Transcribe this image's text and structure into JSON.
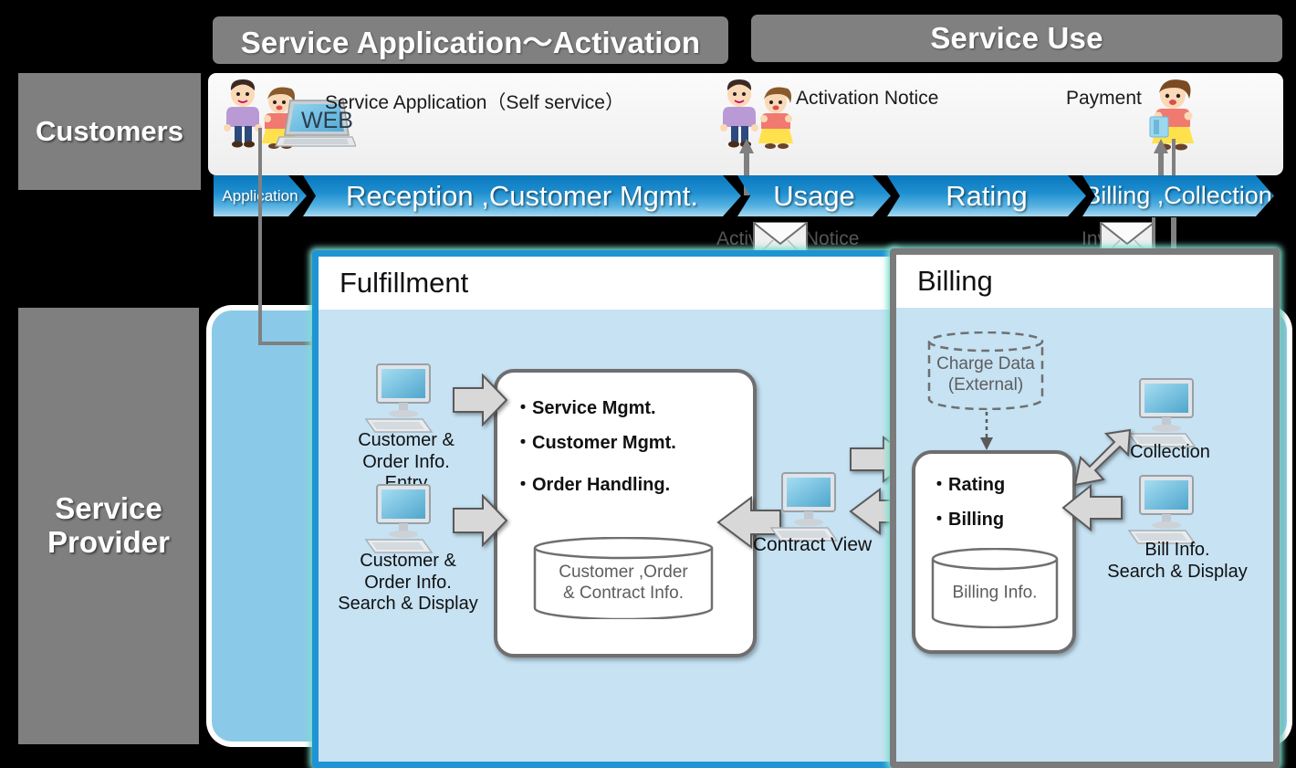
{
  "phases": [
    {
      "id": "application-activation",
      "label": "Service Application～Activation"
    },
    {
      "id": "service-use",
      "label": "Service Use"
    }
  ],
  "roles": {
    "customers": "Customers",
    "provider": "Service\nProvider"
  },
  "customer_lane": {
    "items": [
      {
        "id": "service-application",
        "label": "Service Application（Self service）"
      },
      {
        "id": "activation-notice",
        "label": "Activation Notice"
      },
      {
        "id": "payment",
        "label": "Payment"
      }
    ],
    "web_badge": "WEB"
  },
  "process_chevrons": [
    {
      "id": "application",
      "label": "Application"
    },
    {
      "id": "reception-customer-mgmt",
      "label": "Reception ,Customer Mgmt."
    },
    {
      "id": "usage",
      "label": "Usage"
    },
    {
      "id": "rating",
      "label": "Rating"
    },
    {
      "id": "billing-collection",
      "label": "Billing ,Collection"
    }
  ],
  "documents": [
    {
      "id": "activation-notice-doc",
      "label": "Activation Notice"
    },
    {
      "id": "invoice-doc",
      "label": "Invoice"
    }
  ],
  "systems": [
    {
      "id": "fulfillment",
      "title": "Fulfillment",
      "functions": [
        "・Service Mgmt.",
        "・Customer Mgmt.",
        "・Order Handling."
      ],
      "datastore": "Customer ,Order\n& Contract Info.",
      "actors": [
        {
          "id": "entry",
          "label": "Customer &\nOrder Info.\nEntry"
        },
        {
          "id": "search-display",
          "label": "Customer &\nOrder Info.\nSearch & Display"
        }
      ]
    },
    {
      "id": "billing",
      "title": "Billing",
      "functions": [
        "・Rating",
        "・Billing"
      ],
      "datastore": "Billing Info.",
      "external_datastore": "Charge Data\n(External)",
      "actors": [
        {
          "id": "collection",
          "label": "Collection"
        },
        {
          "id": "bill-info-search",
          "label": "Bill Info.\nSearch & Display"
        }
      ]
    }
  ],
  "shared": {
    "contract_view": "Contract View"
  },
  "colors": {
    "phase_bar": "#808080",
    "role_label": "#7f7f7f",
    "chevron_blue": "#1e8fd0",
    "provider_container": "#8bc9e8",
    "panel_fill": "#c6e2f3",
    "fulfillment_border": "#1f94d4",
    "billing_border": "#7b7b7b",
    "glow": "#7fe0cf",
    "arrow_gray": "#d8d8d8"
  }
}
